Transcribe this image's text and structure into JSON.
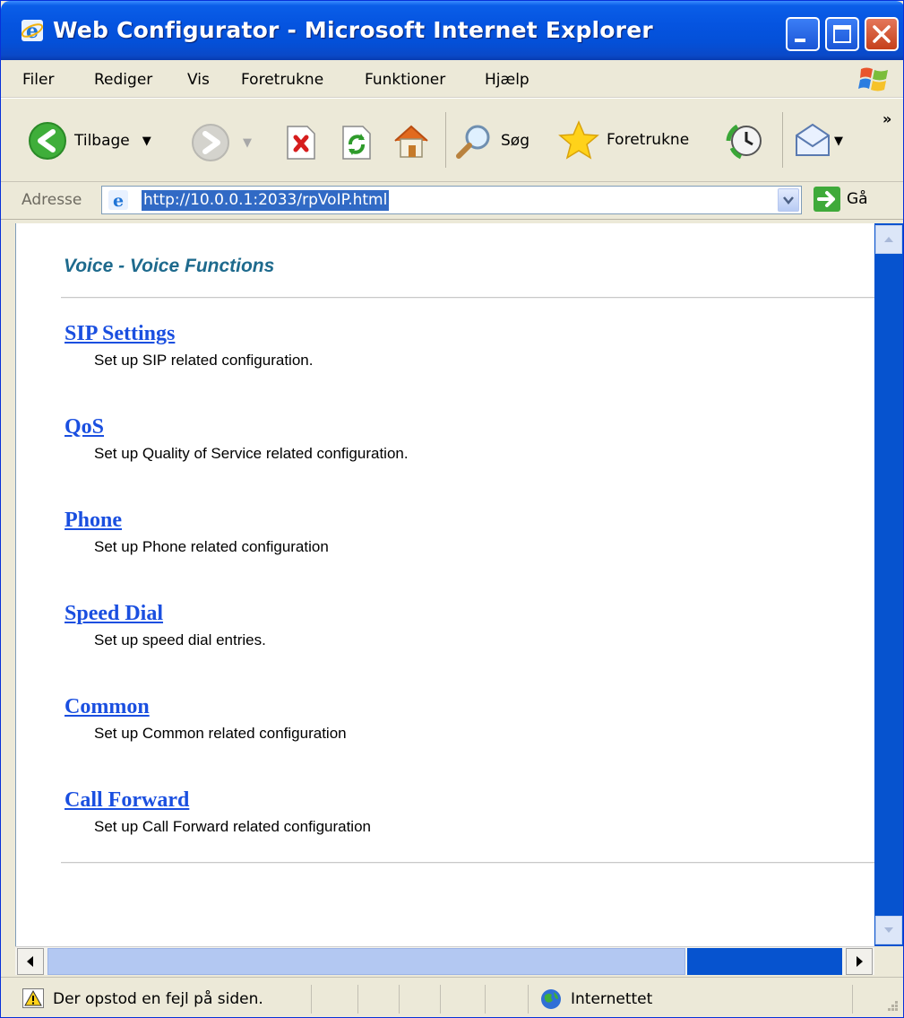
{
  "window": {
    "title": "Web Configurator - Microsoft Internet Explorer"
  },
  "menu": {
    "items": [
      "Filer",
      "Rediger",
      "Vis",
      "Foretrukne",
      "Funktioner",
      "Hjælp"
    ]
  },
  "toolbar": {
    "back_label": "Tilbage",
    "search_label": "Søg",
    "favorites_label": "Foretrukne"
  },
  "address": {
    "label": "Adresse",
    "url": "http://10.0.0.1:2033/rpVoIP.html",
    "go_label": "Gå"
  },
  "page": {
    "title": "Voice - Voice Functions",
    "sections": [
      {
        "link": "SIP Settings",
        "desc": "Set up SIP related configuration."
      },
      {
        "link": "QoS",
        "desc": "Set up Quality of Service related configuration."
      },
      {
        "link": "Phone",
        "desc": "Set up Phone related configuration"
      },
      {
        "link": "Speed Dial",
        "desc": "Set up speed dial entries."
      },
      {
        "link": "Common",
        "desc": "Set up Common related configuration"
      },
      {
        "link": "Call Forward",
        "desc": "Set up Call Forward related configuration"
      }
    ]
  },
  "status": {
    "message": "Der opstod en fejl på siden.",
    "zone": "Internettet"
  },
  "colors": {
    "titlebar": "#0554e0",
    "link": "#1a4fe0",
    "page_title": "#1e6a8d",
    "scrollbar": "#0653cf"
  }
}
